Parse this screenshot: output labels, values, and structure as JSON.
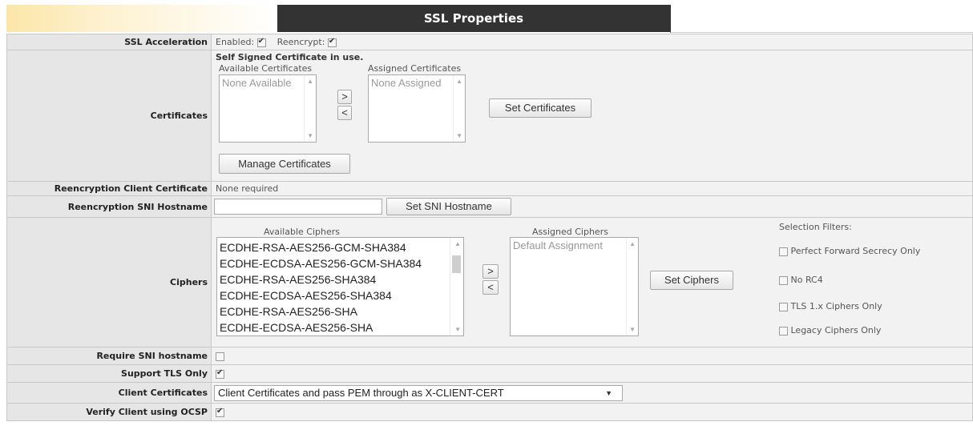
{
  "header": {
    "title": "SSL Properties"
  },
  "ssl_acceleration": {
    "label": "SSL Acceleration",
    "enabled_label": "Enabled:",
    "enabled_checked": true,
    "reencrypt_label": "Reencrypt:",
    "reencrypt_checked": true
  },
  "certificates": {
    "label": "Certificates",
    "status": "Self Signed Certificate in use.",
    "available_caption": "Available Certificates",
    "available_value": "None Available",
    "assigned_caption": "Assigned Certificates",
    "assigned_value": "None Assigned",
    "move_right": ">",
    "move_left": "<",
    "set_button": "Set Certificates",
    "manage_button": "Manage Certificates"
  },
  "reencryption_client_certificate": {
    "label": "Reencryption Client Certificate",
    "value": "None required"
  },
  "reencryption_sni_hostname": {
    "label": "Reencryption SNI Hostname",
    "input_value": "",
    "button": "Set SNI Hostname"
  },
  "ciphers": {
    "label": "Ciphers",
    "available_caption": "Available Ciphers",
    "available": [
      "ECDHE-RSA-AES256-GCM-SHA384",
      "ECDHE-ECDSA-AES256-GCM-SHA384",
      "ECDHE-RSA-AES256-SHA384",
      "ECDHE-ECDSA-AES256-SHA384",
      "ECDHE-RSA-AES256-SHA",
      "ECDHE-ECDSA-AES256-SHA"
    ],
    "assigned_caption": "Assigned Ciphers",
    "assigned_value": "Default Assignment",
    "move_right": ">",
    "move_left": "<",
    "set_button": "Set Ciphers",
    "filters_caption": "Selection Filters:",
    "filters": [
      {
        "label": "Perfect Forward Secrecy Only",
        "checked": false
      },
      {
        "label": "No RC4",
        "checked": false
      },
      {
        "label": "TLS 1.x Ciphers Only",
        "checked": false
      },
      {
        "label": "Legacy Ciphers Only",
        "checked": false
      }
    ]
  },
  "require_sni": {
    "label": "Require SNI hostname",
    "checked": false
  },
  "support_tls_only": {
    "label": "Support TLS Only",
    "checked": true
  },
  "client_certificates": {
    "label": "Client Certificates",
    "selected": "Client Certificates and pass PEM through as X-CLIENT-CERT"
  },
  "verify_ocsp": {
    "label": "Verify Client using OCSP",
    "checked": true
  }
}
